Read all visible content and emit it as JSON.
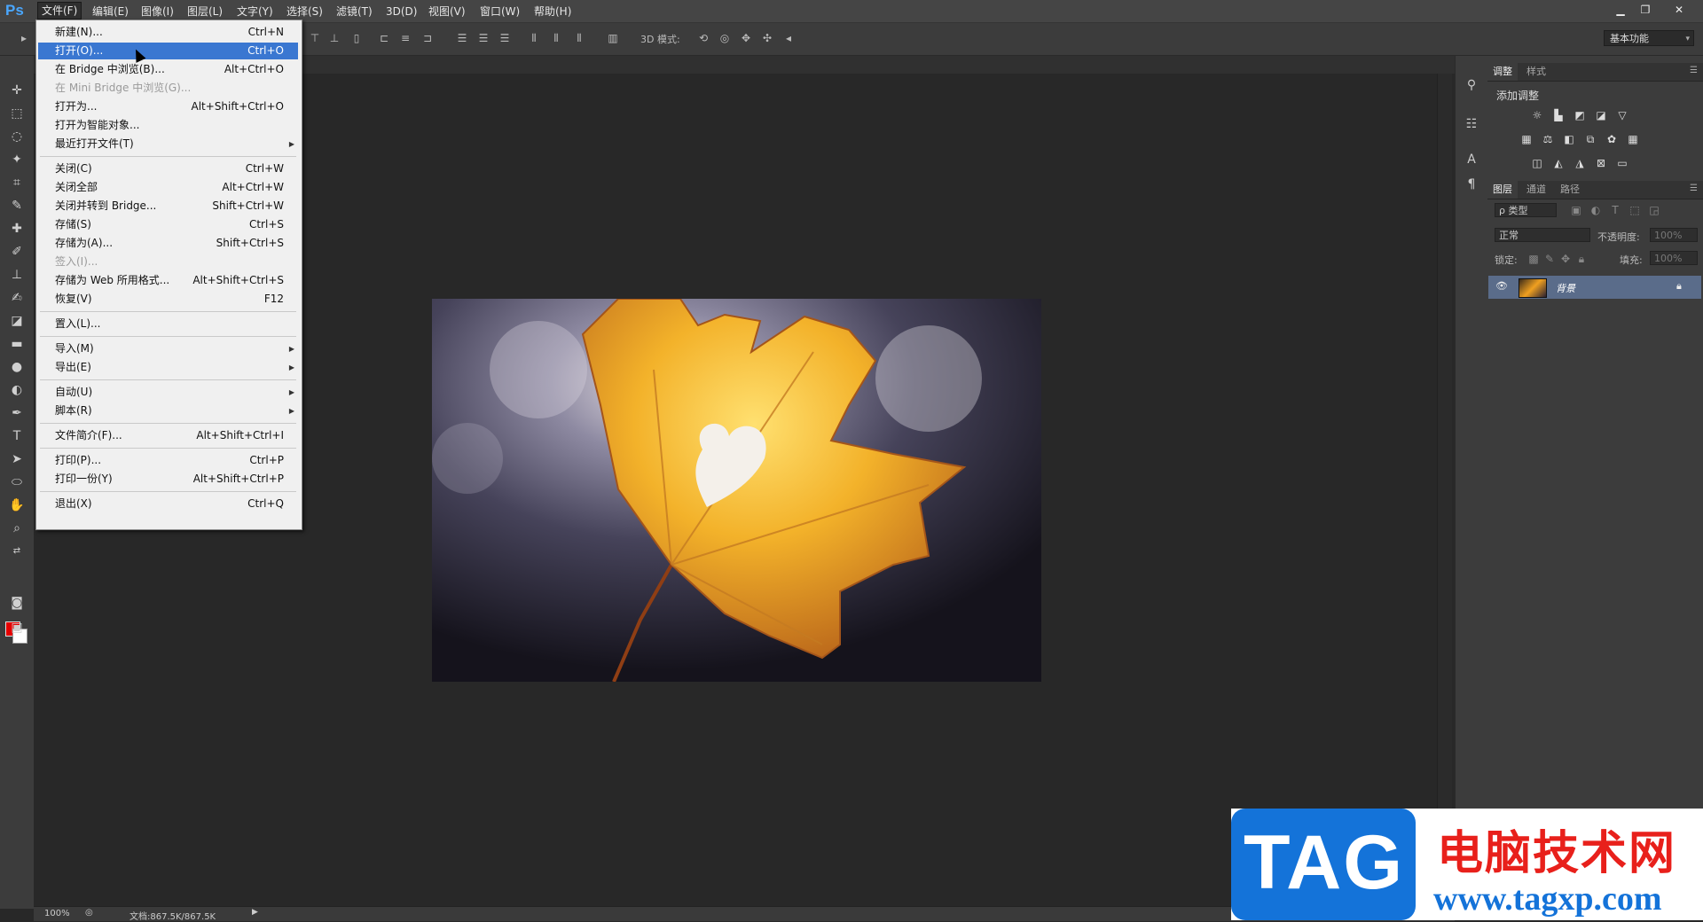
{
  "app": {
    "logo": "Ps"
  },
  "menubar": {
    "items": [
      "文件(F)",
      "编辑(E)",
      "图像(I)",
      "图层(L)",
      "文字(Y)",
      "选择(S)",
      "滤镜(T)",
      "3D(D)",
      "视图(V)",
      "窗口(W)",
      "帮助(H)"
    ],
    "window_controls": {
      "minimize": "▁",
      "restore": "❐",
      "close": "✕"
    }
  },
  "options_bar": {
    "mode_3d_label": "3D 模式:",
    "workspace": "基本功能"
  },
  "file_menu": {
    "items": [
      {
        "label": "新建(N)...",
        "shortcut": "Ctrl+N"
      },
      {
        "label": "打开(O)...",
        "shortcut": "Ctrl+O",
        "highlighted": true
      },
      {
        "label": "在 Bridge 中浏览(B)...",
        "shortcut": "Alt+Ctrl+O"
      },
      {
        "label": "在 Mini Bridge 中浏览(G)...",
        "shortcut": "",
        "disabled": true
      },
      {
        "label": "打开为...",
        "shortcut": "Alt+Shift+Ctrl+O"
      },
      {
        "label": "打开为智能对象...",
        "shortcut": ""
      },
      {
        "label": "最近打开文件(T)",
        "shortcut": "",
        "submenu": true
      },
      {
        "label": "关闭(C)",
        "shortcut": "Ctrl+W"
      },
      {
        "label": "关闭全部",
        "shortcut": "Alt+Ctrl+W"
      },
      {
        "label": "关闭并转到 Bridge...",
        "shortcut": "Shift+Ctrl+W"
      },
      {
        "label": "存储(S)",
        "shortcut": "Ctrl+S"
      },
      {
        "label": "存储为(A)...",
        "shortcut": "Shift+Ctrl+S"
      },
      {
        "label": "签入(I)...",
        "shortcut": "",
        "disabled": true
      },
      {
        "label": "存储为 Web 所用格式...",
        "shortcut": "Alt+Shift+Ctrl+S"
      },
      {
        "label": "恢复(V)",
        "shortcut": "F12"
      },
      {
        "label": "置入(L)...",
        "shortcut": ""
      },
      {
        "label": "导入(M)",
        "shortcut": "",
        "submenu": true
      },
      {
        "label": "导出(E)",
        "shortcut": "",
        "submenu": true
      },
      {
        "label": "自动(U)",
        "shortcut": "",
        "submenu": true
      },
      {
        "label": "脚本(R)",
        "shortcut": "",
        "submenu": true
      },
      {
        "label": "文件简介(F)...",
        "shortcut": "Alt+Shift+Ctrl+I"
      },
      {
        "label": "打印(P)...",
        "shortcut": "Ctrl+P"
      },
      {
        "label": "打印一份(Y)",
        "shortcut": "Alt+Shift+Ctrl+P"
      },
      {
        "label": "退出(X)",
        "shortcut": "Ctrl+Q"
      }
    ]
  },
  "status_bar": {
    "zoom": "100%",
    "doc_info": "文档:867.5K/867.5K"
  },
  "adjust_panel": {
    "tabs": [
      "调整",
      "样式"
    ],
    "title": "添加调整"
  },
  "layers_panel": {
    "tabs": [
      "图层",
      "通道",
      "路径"
    ],
    "filter": "ρ 类型",
    "blend_mode": "正常",
    "opacity_label": "不透明度:",
    "opacity_value": "100%",
    "lock_label": "锁定:",
    "fill_label": "填充:",
    "fill_value": "100%",
    "layers": [
      {
        "name": "背景"
      }
    ]
  },
  "watermark": {
    "tag": "TAG",
    "title": "电脑技术网",
    "url": "www.tagxp.com"
  },
  "colors": {
    "foreground": "#e60000",
    "background": "#ffffff",
    "highlight": "#3a77d1"
  }
}
